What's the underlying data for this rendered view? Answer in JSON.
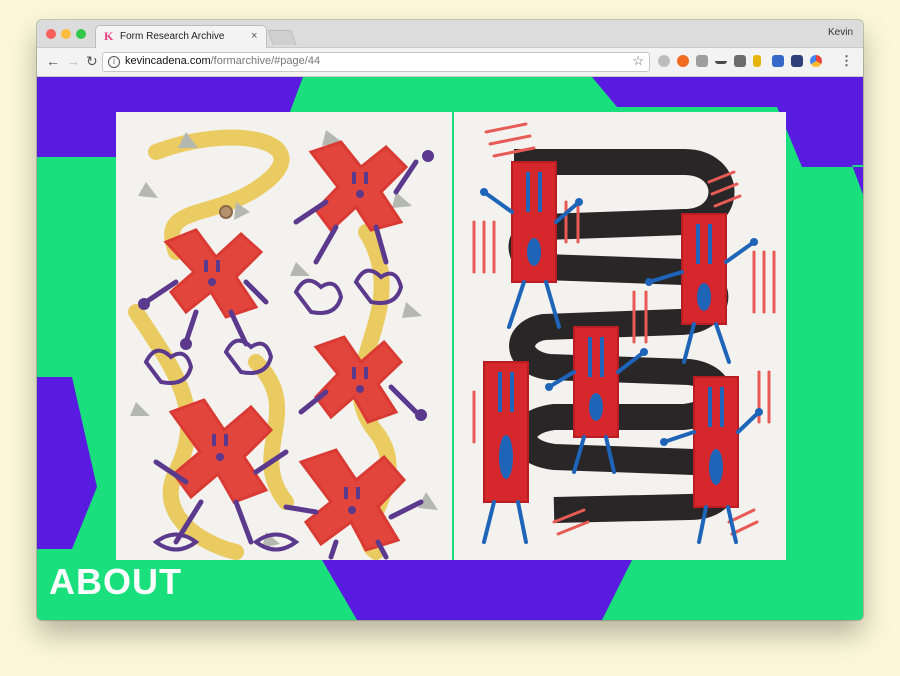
{
  "browser": {
    "tab_title": "Form Research Archive",
    "tab_close": "×",
    "profile_name": "Kevin",
    "favicon_letter": "K",
    "url_domain": "kevincadena.com",
    "url_path": "/formarchive/#page/44",
    "back_glyph": "←",
    "forward_glyph": "→",
    "reload_glyph": "↻",
    "info_glyph": "i",
    "star_glyph": "☆",
    "menu_glyph": "⋮",
    "traffic_lights": [
      "#fc605c",
      "#fdbc40",
      "#34c84a"
    ],
    "extensions": [
      {
        "name": "cloud-icon",
        "color": "#bdbdbd"
      },
      {
        "name": "orange-circle-icon",
        "color": "#f26b21"
      },
      {
        "name": "grid-icon",
        "color": "#9e9e9e"
      },
      {
        "name": "wave-icon",
        "color": "#4a4a4a"
      },
      {
        "name": "evernote-icon",
        "color": "#6c6c6c"
      },
      {
        "name": "bookmark-icon",
        "color": "#e7b40c"
      },
      {
        "name": "info-ext-icon",
        "color": "#3469c7"
      },
      {
        "name": "library-icon",
        "color": "#2e3f7a"
      },
      {
        "name": "chrome-icon",
        "color": "#e8453c"
      }
    ]
  },
  "page": {
    "about_label": "ABOUT",
    "colors": {
      "green": "#19e07c",
      "purple": "#5a1be0",
      "paper": "#f4f2ee",
      "red": "#e13a34",
      "blue": "#1e64b8",
      "black": "#1c1a1a"
    }
  }
}
